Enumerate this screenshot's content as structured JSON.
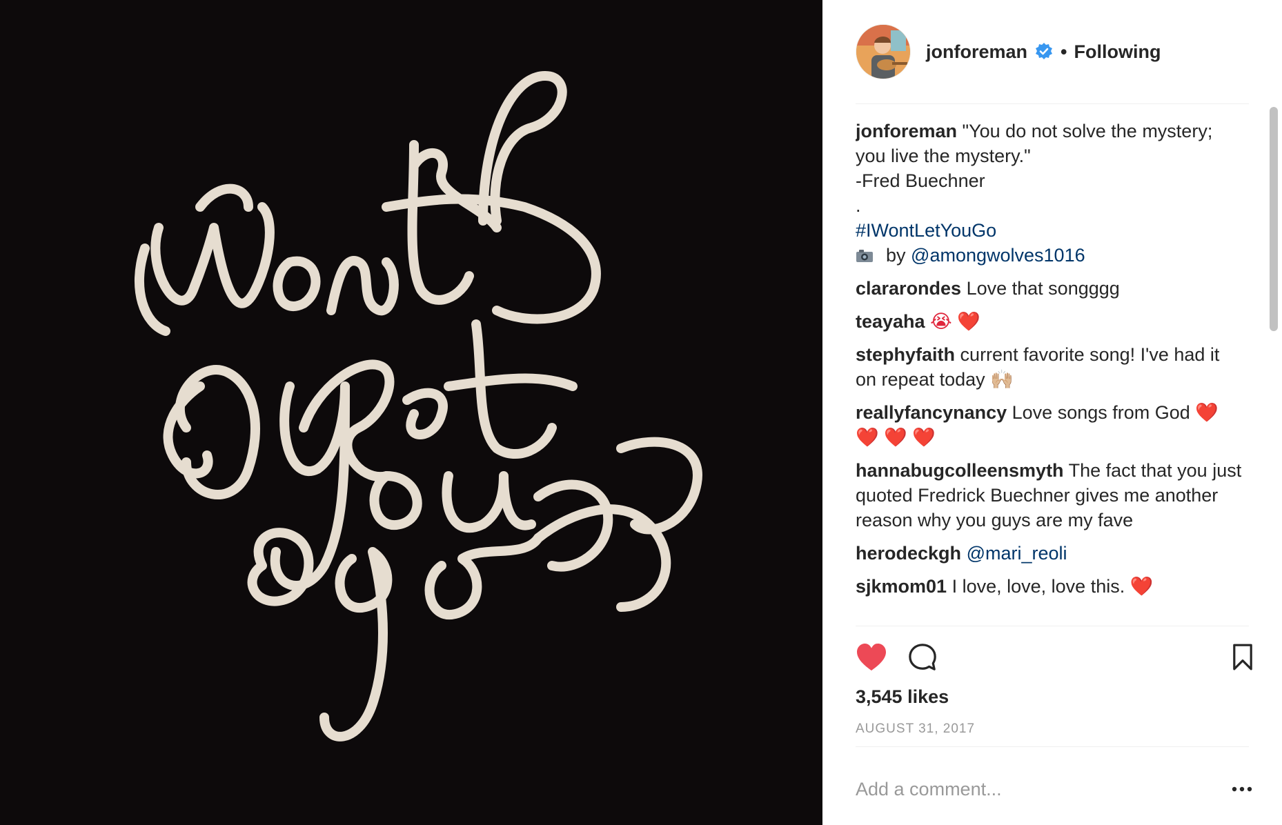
{
  "post": {
    "image_text": "I Wont Let You Go",
    "colors": {
      "media_bg": "#0d0a0b",
      "lettering": "#e6ddd0",
      "link": "#003569",
      "like": "#ed4956",
      "muted": "#999999"
    }
  },
  "header": {
    "username": "jonforeman",
    "verified_icon": "verified-badge-icon",
    "separator": "•",
    "follow_status": "Following"
  },
  "caption": {
    "user": "jonforeman",
    "line1": "\"You do not solve the mystery; you live the mystery.\"",
    "line2": "-Fred Buechner",
    "line3": ".",
    "hashtag": "#IWontLetYouGo",
    "credit_prefix": "by",
    "credit_mention": "@amongwolves1016"
  },
  "comments": [
    {
      "user": "clararondes",
      "text": "Love that songggg"
    },
    {
      "user": "teayaha",
      "text": "😭 ❤️"
    },
    {
      "user": "stephyfaith",
      "text": "current favorite song! I've had it on repeat today 🙌🏼"
    },
    {
      "user": "reallyfancynancy",
      "text": "Love songs from God ❤️ ❤️ ❤️ ❤️"
    },
    {
      "user": "hannabugcolleensmyth",
      "text": "The fact that you just quoted Fredrick Buechner gives me another reason why you guys are my fave"
    },
    {
      "user": "herodeckgh",
      "mention": "@mari_reoli"
    },
    {
      "user": "sjkmom01",
      "text": "I love, love, love this. ❤️"
    }
  ],
  "actions": {
    "like_icon": "heart-icon",
    "comment_icon": "comment-bubble-icon",
    "save_icon": "bookmark-icon",
    "liked": true
  },
  "likes": "3,545 likes",
  "date": "AUGUST 31, 2017",
  "add_comment": {
    "placeholder": "Add a comment...",
    "more_icon": "more-options-icon"
  }
}
